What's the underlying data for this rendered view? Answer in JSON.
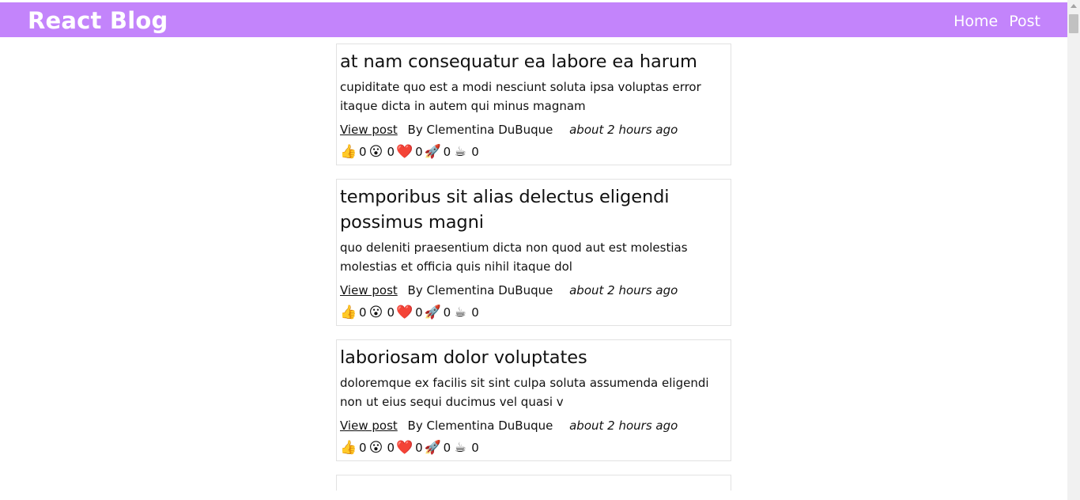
{
  "header": {
    "brand": "React Blog",
    "nav": [
      {
        "label": "Home"
      },
      {
        "label": "Post"
      }
    ]
  },
  "reaction_icons": [
    "thumbs-up-icon",
    "wow-face-icon",
    "heart-icon",
    "rocket-icon",
    "coffee-icon"
  ],
  "reaction_glyphs": [
    "👍",
    "😮",
    "❤️",
    "🚀",
    "☕"
  ],
  "posts": [
    {
      "title": "at nam consequatur ea labore ea harum",
      "excerpt": "cupiditate quo est a modi nesciunt soluta ipsa voluptas error itaque dicta in autem qui minus magnam",
      "view_label": "View post",
      "author": "By Clementina DuBuque",
      "time": "about 2 hours ago",
      "reactions": [
        "0",
        "0",
        "0",
        "0",
        "0"
      ]
    },
    {
      "title": "temporibus sit alias delectus eligendi possimus magni",
      "excerpt": "quo deleniti praesentium dicta non quod aut est molestias molestias et officia quis nihil itaque dol",
      "view_label": "View post",
      "author": "By Clementina DuBuque",
      "time": "about 2 hours ago",
      "reactions": [
        "0",
        "0",
        "0",
        "0",
        "0"
      ]
    },
    {
      "title": "laboriosam dolor voluptates",
      "excerpt": "doloremque ex facilis sit sint culpa soluta assumenda eligendi non ut eius sequi ducimus vel quasi v",
      "view_label": "View post",
      "author": "By Clementina DuBuque",
      "time": "about 2 hours ago",
      "reactions": [
        "0",
        "0",
        "0",
        "0",
        "0"
      ]
    }
  ],
  "colors": {
    "header_bg": "#c384fb",
    "header_text": "#ffffff",
    "card_border": "#e2e2e2"
  }
}
